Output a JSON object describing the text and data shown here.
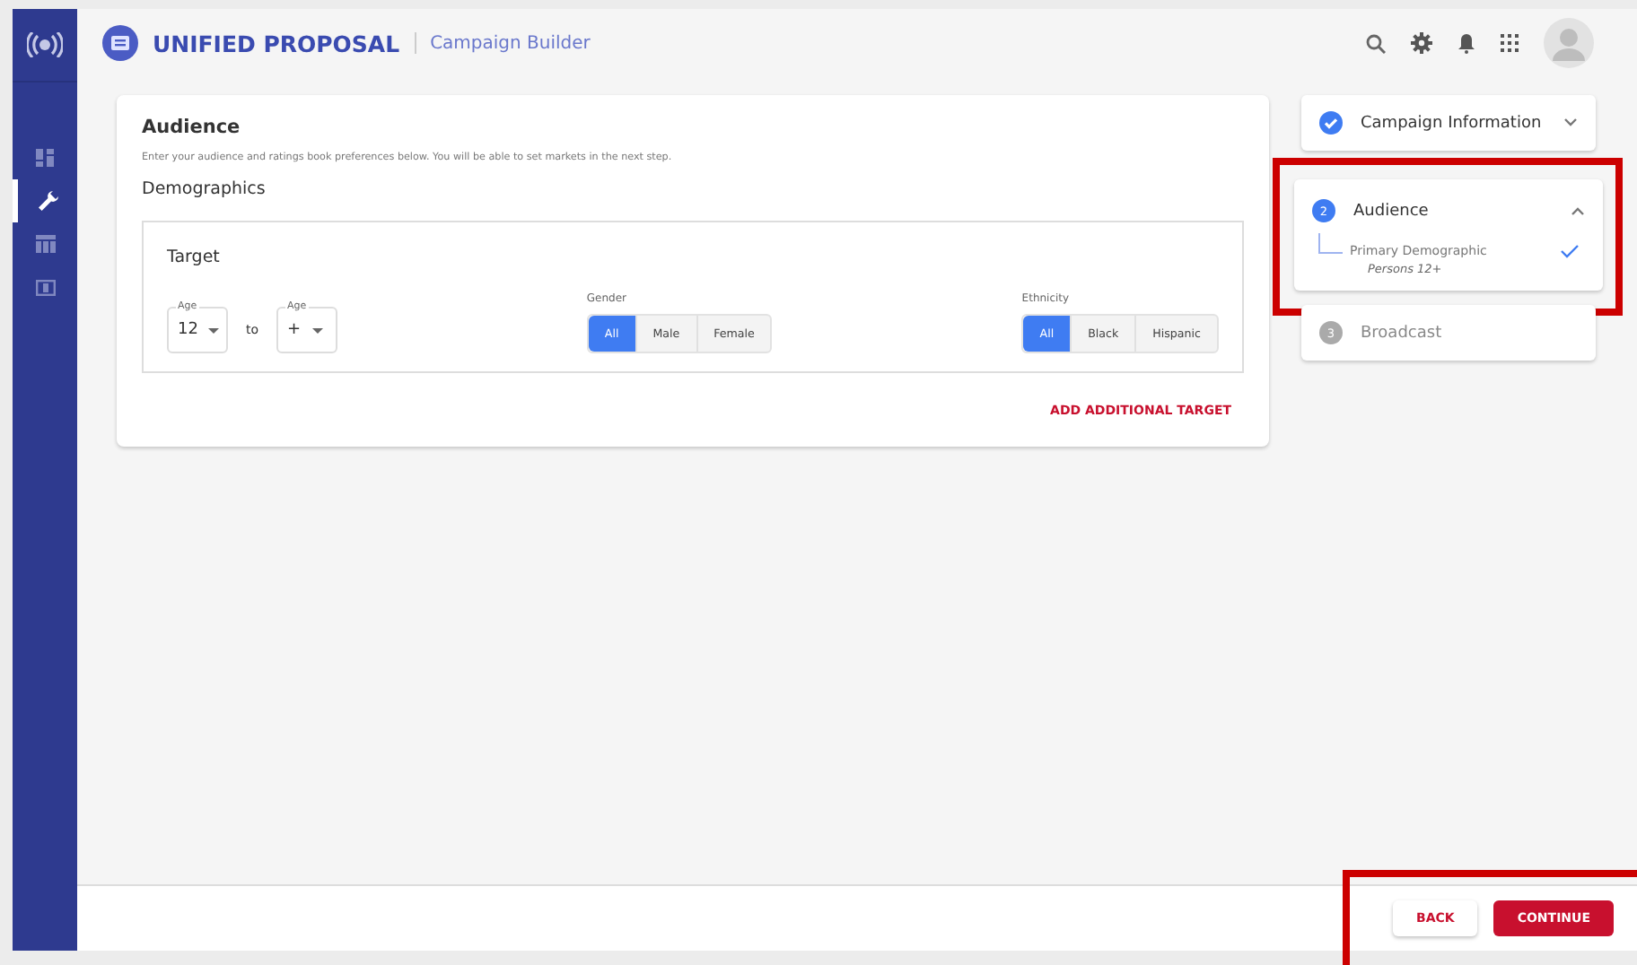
{
  "header": {
    "title": "UNIFIED PROPOSAL",
    "subtitle": "Campaign Builder"
  },
  "nav": [
    {
      "kind": "dashboard",
      "selected": false
    },
    {
      "kind": "wrench",
      "selected": true
    },
    {
      "kind": "table",
      "selected": false
    },
    {
      "kind": "money",
      "selected": false
    }
  ],
  "audience": {
    "title": "Audience",
    "description": "Enter your audience and ratings book preferences below. You will be able to set markets in the next step.",
    "section": "Demographics",
    "target": {
      "title": "Target",
      "age_from": {
        "label": "Age",
        "value": "12"
      },
      "to": "to",
      "age_to": {
        "label": "Age",
        "value": "+"
      },
      "gender": {
        "label": "Gender",
        "options": [
          {
            "label": "All",
            "selected": true
          },
          {
            "label": "Male",
            "selected": false
          },
          {
            "label": "Female",
            "selected": false
          }
        ]
      },
      "ethnicity": {
        "label": "Ethnicity",
        "options": [
          {
            "label": "All",
            "selected": true
          },
          {
            "label": "Black",
            "selected": false
          },
          {
            "label": "Hispanic",
            "selected": false
          }
        ]
      }
    },
    "add_target": "ADD ADDITIONAL TARGET"
  },
  "steps": [
    {
      "kind": "done",
      "title": "Campaign Information",
      "expanded": false
    },
    {
      "kind": "active",
      "number": "2",
      "title": "Audience",
      "expanded": true,
      "sub": {
        "title": "Primary Demographic",
        "detail": "Persons 12+"
      }
    },
    {
      "kind": "pending",
      "number": "3",
      "title": "Broadcast"
    }
  ],
  "footer": {
    "back": "BACK",
    "continue": "CONTINUE"
  }
}
